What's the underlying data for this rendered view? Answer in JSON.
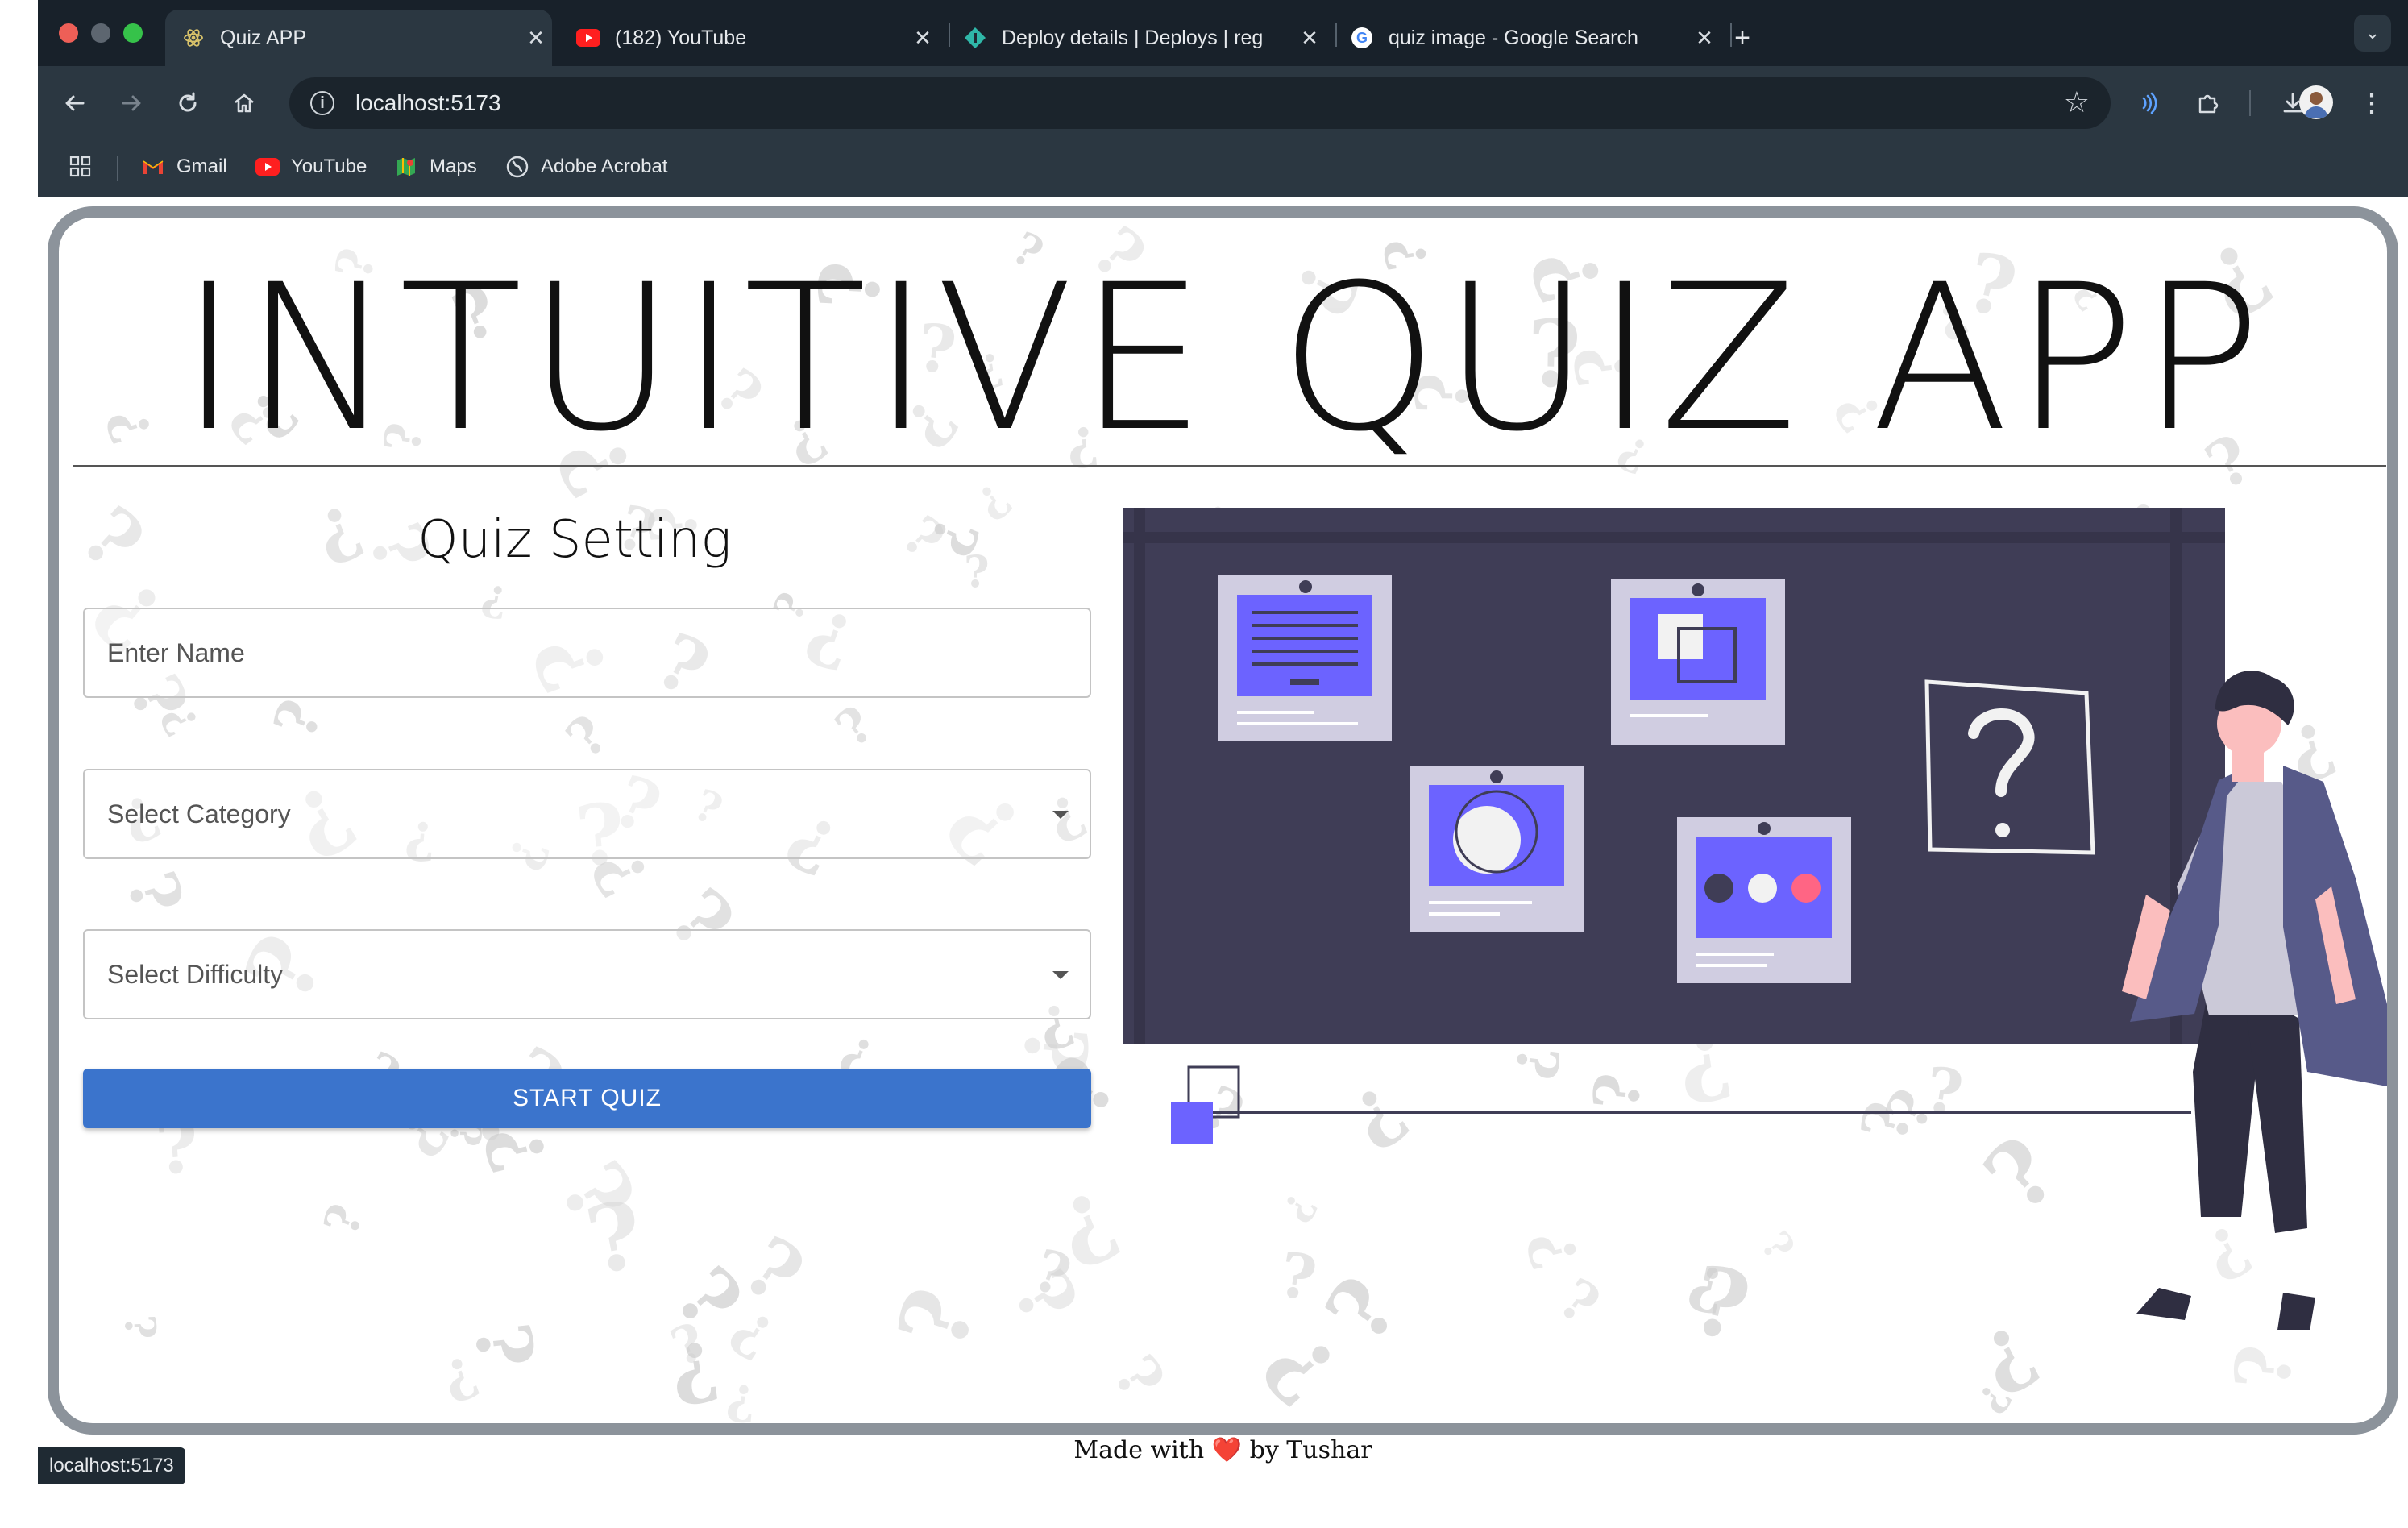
{
  "browser": {
    "tabs": [
      {
        "title": "Quiz APP",
        "active": true,
        "icon": "react-icon"
      },
      {
        "title": "(182) YouTube",
        "active": false,
        "icon": "youtube-icon"
      },
      {
        "title": "Deploy details | Deploys | reg",
        "active": false,
        "icon": "netlify-icon"
      },
      {
        "title": "quiz image - Google Search",
        "active": false,
        "icon": "google-icon"
      }
    ],
    "new_tab": "+",
    "address": "localhost:5173",
    "bookmarks": [
      {
        "label": "Gmail",
        "icon": "gmail-icon"
      },
      {
        "label": "YouTube",
        "icon": "youtube-icon"
      },
      {
        "label": "Maps",
        "icon": "maps-icon"
      },
      {
        "label": "Adobe Acrobat",
        "icon": "globe-icon"
      }
    ],
    "status_url": "localhost:5173"
  },
  "app": {
    "title": "INTUITIVE QUIZ APP",
    "settings_title": "Quiz Setting",
    "name_placeholder": "Enter Name",
    "category_placeholder": "Select Category",
    "difficulty_placeholder": "Select Difficulty",
    "start_label": "START QUIZ",
    "footer_prefix": "Made with",
    "footer_heart": "❤️",
    "footer_suffix": "by Tushar"
  },
  "colors": {
    "accent": "#3b74cc",
    "board": "#3f3d56",
    "card_fill": "#6c63ff"
  }
}
